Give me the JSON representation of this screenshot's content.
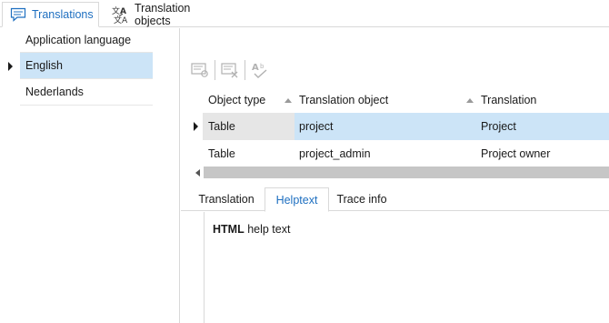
{
  "top_tabs": {
    "translations": "Translations",
    "translation_objects": "Translation objects"
  },
  "languages": {
    "header": "Application language",
    "items": [
      "English",
      "Nederlands"
    ],
    "selected": "English"
  },
  "grid": {
    "columns": [
      "Object type",
      "Translation object",
      "Translation"
    ],
    "rows": [
      [
        "Table",
        "project",
        "Project"
      ],
      [
        "Table",
        "project_admin",
        "Project owner"
      ]
    ]
  },
  "bottom_tabs": [
    "Translation",
    "Helptext",
    "Trace info"
  ],
  "help": {
    "bold": "HTML",
    "rest": " help text"
  },
  "colors": {
    "accent": "#1e6fc0",
    "selection": "#cce4f7"
  }
}
